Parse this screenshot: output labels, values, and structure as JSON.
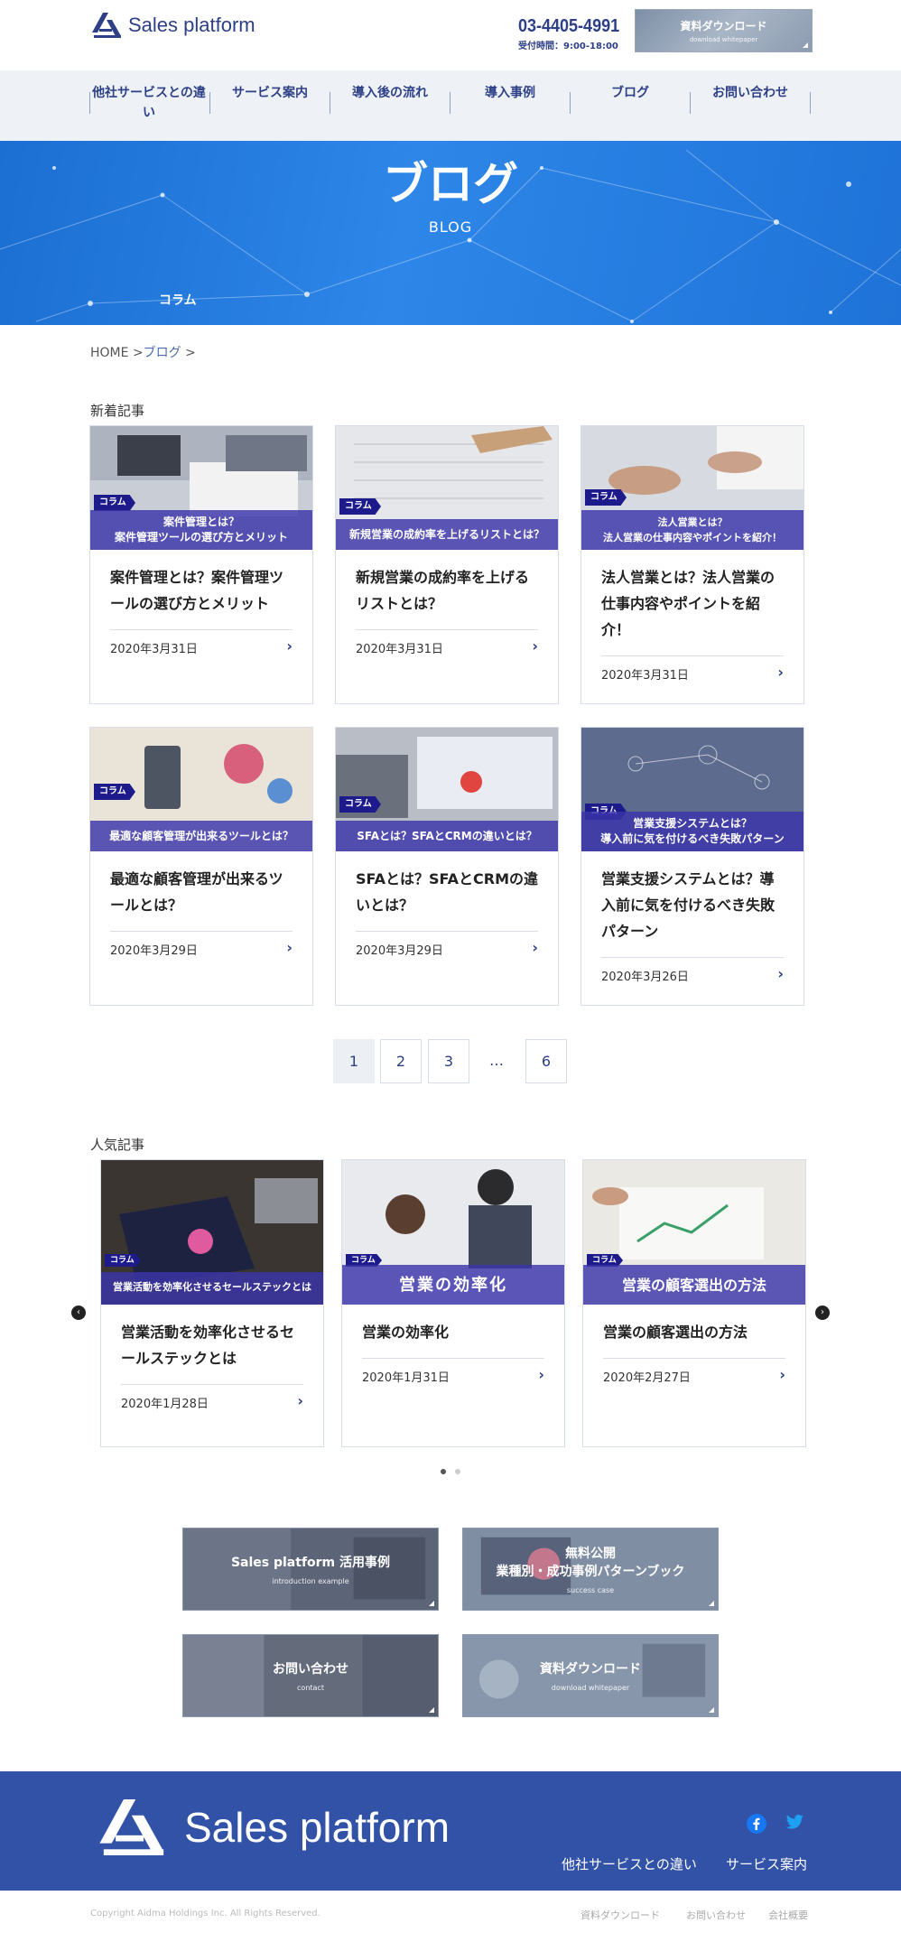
{
  "header": {
    "logo_text": "Sales platform",
    "phone": "03-4405-4991",
    "hours": "受付時間：9:00-18:00",
    "download_label": "資料ダウンロード",
    "download_sub": "download whitepaper"
  },
  "nav": {
    "items": [
      {
        "label": "他社サービスとの違い"
      },
      {
        "label": "サービス案内"
      },
      {
        "label": "導入後の流れ"
      },
      {
        "label": "導入事例"
      },
      {
        "label": "ブログ"
      },
      {
        "label": "お問い合わせ"
      }
    ]
  },
  "hero": {
    "title": "ブログ",
    "subtitle": "BLOG",
    "category": "コラム"
  },
  "breadcrumb": {
    "home": "HOME",
    "sep1": ">",
    "blog": "ブログ",
    "sep2": ">"
  },
  "latest": {
    "title": "新着記事",
    "badge": "コラム",
    "cards": [
      {
        "band": "案件管理とは？\n案件管理ツールの選び方とメリット",
        "title": "案件管理とは？案件管理ツールの選び方とメリット",
        "date": "2020年3月31日"
      },
      {
        "band": "新規営業の成約率を上げるリストとは？",
        "title": "新規営業の成約率を上げるリストとは？",
        "date": "2020年3月31日"
      },
      {
        "band": "法人営業とは？\n法人営業の仕事内容やポイントを紹介！",
        "title": "法人営業とは？法人営業の仕事内容やポイントを紹介！",
        "date": "2020年3月31日"
      },
      {
        "band": "最適な顧客管理が出来るツールとは？",
        "title": "最適な顧客管理が出来るツールとは？",
        "date": "2020年3月29日"
      },
      {
        "band": "SFAとは？SFAとCRMの違いとは？",
        "title": "SFAとは？SFAとCRMの違いとは？",
        "date": "2020年3月29日"
      },
      {
        "band": "営業支援システムとは？\n導入前に気を付けるべき失敗パターン",
        "title": "営業支援システムとは？導入前に気を付けるべき失敗パターン",
        "date": "2020年3月26日"
      }
    ]
  },
  "pagination": {
    "pages": [
      "1",
      "2",
      "3",
      "6"
    ],
    "ellipsis": "…"
  },
  "popular": {
    "title": "人気記事",
    "badge": "コラム",
    "cards": [
      {
        "band": "営業活動を効率化させるセールステックとは",
        "title": "営業活動を効率化させるセールステックとは",
        "date": "2020年1月28日"
      },
      {
        "band": "営業の効率化",
        "title": "営業の効率化",
        "date": "2020年1月31日"
      },
      {
        "band": "営業の顧客選出の方法",
        "title": "営業の顧客選出の方法",
        "date": "2020年2月27日"
      }
    ],
    "prev_icon": "‹",
    "next_icon": "›"
  },
  "banners": [
    {
      "title": "Sales platform 活用事例",
      "sub": "introduction example"
    },
    {
      "title": "無料公開\n業種別・成功事例パターンブック",
      "sub": "success case"
    },
    {
      "title": "お問い合わせ",
      "sub": "contact"
    },
    {
      "title": "資料ダウンロード",
      "sub": "download whitepaper"
    }
  ],
  "footer": {
    "logo_text": "Sales platform",
    "links": [
      "他社サービスとの違い",
      "サービス案内"
    ],
    "copyright": "Copyright Aidma Holdings Inc. All Rights Reserved.",
    "bottom_links": [
      "資料ダウンロード",
      "お問い合わせ",
      "会社概要"
    ]
  },
  "colors": {
    "brand": "#2d3f87",
    "hero": "#2d86e8",
    "footer": "#3152a6",
    "band": "#3a34aa"
  }
}
